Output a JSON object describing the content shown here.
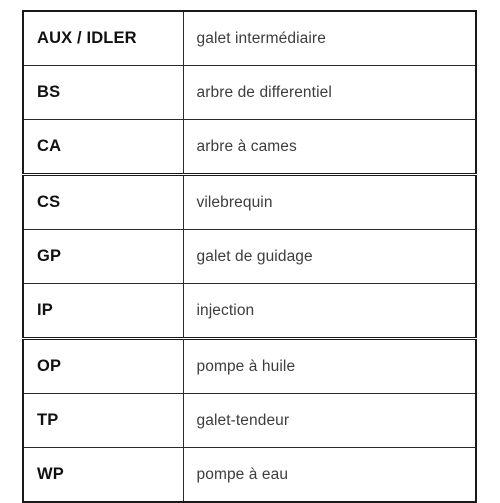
{
  "document": {
    "kind": "abbreviation-legend-table",
    "language": "fr",
    "background_color": "#ffffff",
    "border_color": "#1a1a1a",
    "code_text_color": "#111111",
    "description_text_color": "#3d3d3d"
  },
  "table": {
    "columns": [
      {
        "key": "code",
        "header": ""
      },
      {
        "key": "description",
        "header": ""
      }
    ],
    "rows": [
      {
        "code": "AUX / IDLER",
        "description": "galet intermédiaire",
        "group_end": false
      },
      {
        "code": "BS",
        "description": "arbre de differentiel",
        "group_end": false
      },
      {
        "code": "CA",
        "description": "arbre à cames",
        "group_end": true
      },
      {
        "code": "CS",
        "description": "vilebrequin",
        "group_end": false
      },
      {
        "code": "GP",
        "description": "galet de guidage",
        "group_end": false
      },
      {
        "code": "IP",
        "description": "injection",
        "group_end": true
      },
      {
        "code": "OP",
        "description": "pompe à huile",
        "group_end": false
      },
      {
        "code": "TP",
        "description": "galet-tendeur",
        "group_end": false
      },
      {
        "code": "WP",
        "description": "pompe à eau",
        "group_end": false
      }
    ]
  }
}
